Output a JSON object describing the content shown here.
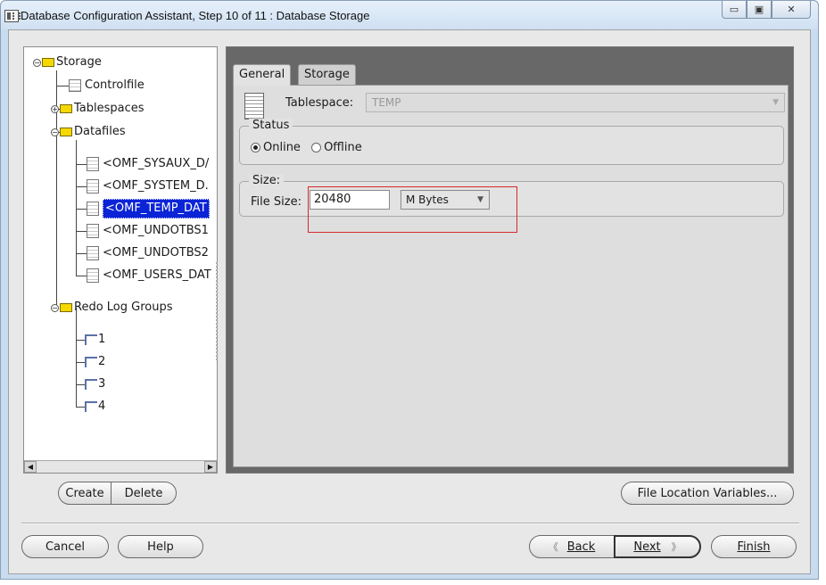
{
  "window": {
    "title": "Database Configuration Assistant, Step 10 of 11 : Database Storage",
    "minimize_glyph": "▭",
    "maximize_glyph": "▣",
    "close_glyph": "✕"
  },
  "tree": {
    "root": "Storage",
    "controlfile": "Controlfile",
    "tablespaces": "Tablespaces",
    "datafiles": "Datafiles",
    "datafile_items": [
      "<OMF_SYSAUX_D/",
      "<OMF_SYSTEM_D.",
      "<OMF_TEMP_DAT",
      "<OMF_UNDOTBS1",
      "<OMF_UNDOTBS2",
      "<OMF_USERS_DAT"
    ],
    "redo_log_groups": "Redo Log Groups",
    "redo_items": [
      "1",
      "2",
      "3",
      "4"
    ]
  },
  "tabs": {
    "general": "General",
    "storage": "Storage"
  },
  "general": {
    "tablespace_label": "Tablespace:",
    "tablespace_value": "TEMP",
    "status_title": "Status",
    "online_label": "Online",
    "offline_label": "Offline",
    "status_selected": "Online",
    "size_title": "Size:",
    "file_size_label": "File Size:",
    "file_size_value": "20480",
    "units_value": "M Bytes"
  },
  "buttons": {
    "create": "Create",
    "delete": "Delete",
    "file_location_variables": "File Location Variables...",
    "cancel": "Cancel",
    "help": "Help",
    "back_arrow": "《",
    "back": "Back",
    "next": "Next",
    "next_arrow": "》",
    "finish": "Finish"
  }
}
